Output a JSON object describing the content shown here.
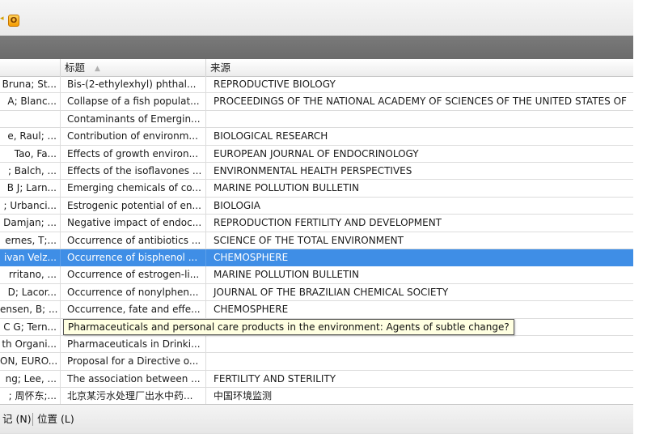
{
  "toolbar": {
    "arrow_icon": "small-arrow-icon",
    "button_icon": "orange-reference-icon",
    "button_glyph": "O"
  },
  "columns": {
    "title": "标题",
    "source": "来源",
    "sort_indicator": "▲"
  },
  "rows": [
    {
      "author": "Bruna; St...",
      "title": "Bis-(2-ethylexhyl) phthal...",
      "source": "REPRODUCTIVE BIOLOGY"
    },
    {
      "author": "A; Blanc...",
      "title": "Collapse of a fish populat...",
      "source": "PROCEEDINGS OF THE NATIONAL ACADEMY OF SCIENCES OF THE UNITED STATES OF"
    },
    {
      "author": "",
      "title": "Contaminants of Emergin...",
      "source": ""
    },
    {
      "author": "e, Raul; ...",
      "title": "Contribution of environm...",
      "source": "BIOLOGICAL RESEARCH"
    },
    {
      "author": "Tao, Fa...",
      "title": "Effects of growth environ...",
      "source": "EUROPEAN JOURNAL OF ENDOCRINOLOGY"
    },
    {
      "author": "; Balch, ...",
      "title": "Effects of the isoflavones ...",
      "source": "ENVIRONMENTAL HEALTH PERSPECTIVES"
    },
    {
      "author": "B J; Larn...",
      "title": "Emerging chemicals of co...",
      "source": "MARINE POLLUTION BULLETIN"
    },
    {
      "author": "; Urbanci...",
      "title": "Estrogenic potential of en...",
      "source": "BIOLOGIA"
    },
    {
      "author": "Damjan; ...",
      "title": "Negative impact of endoc...",
      "source": "REPRODUCTION FERTILITY AND DEVELOPMENT"
    },
    {
      "author": "ernes, T;...",
      "title": "Occurrence of antibiotics ...",
      "source": "SCIENCE OF THE TOTAL ENVIRONMENT"
    },
    {
      "author": "ivan Velz...",
      "title": "Occurrence of bisphenol ...",
      "source": "CHEMOSPHERE",
      "selected": true
    },
    {
      "author": "rritano, ...",
      "title": "Occurrence of estrogen-li...",
      "source": "MARINE POLLUTION BULLETIN"
    },
    {
      "author": "D; Lacor...",
      "title": "Occurrence of nonylphen...",
      "source": "JOURNAL OF THE BRAZILIAN CHEMICAL SOCIETY"
    },
    {
      "author": "ensen, B; ...",
      "title": "Occurrence, fate and effe...",
      "source": "CHEMOSPHERE"
    },
    {
      "author": "C G; Tern...",
      "title": "",
      "source": ""
    },
    {
      "author": "th Organi...",
      "title": "Pharmaceuticals in Drinki...",
      "source": ""
    },
    {
      "author": "ON, EURO...",
      "title": "Proposal for a Directive o...",
      "source": ""
    },
    {
      "author": "ng; Lee, ...",
      "title": "The association between ...",
      "source": "FERTILITY AND STERILITY"
    },
    {
      "author": "; 周怀东;...",
      "title": "北京某污水处理厂出水中药...",
      "source": "中国环境监测"
    }
  ],
  "tooltip": {
    "text": "Pharmaceuticals and personal care products in the environment: Agents of subtle change?"
  },
  "bottom_tabs": {
    "notes": "记 (N)",
    "location": "位置 (L)"
  },
  "colors": {
    "selection": "#3f8ee6",
    "toolbar_dark": "#6f6f6f",
    "tooltip_bg": "#ffffe1"
  }
}
